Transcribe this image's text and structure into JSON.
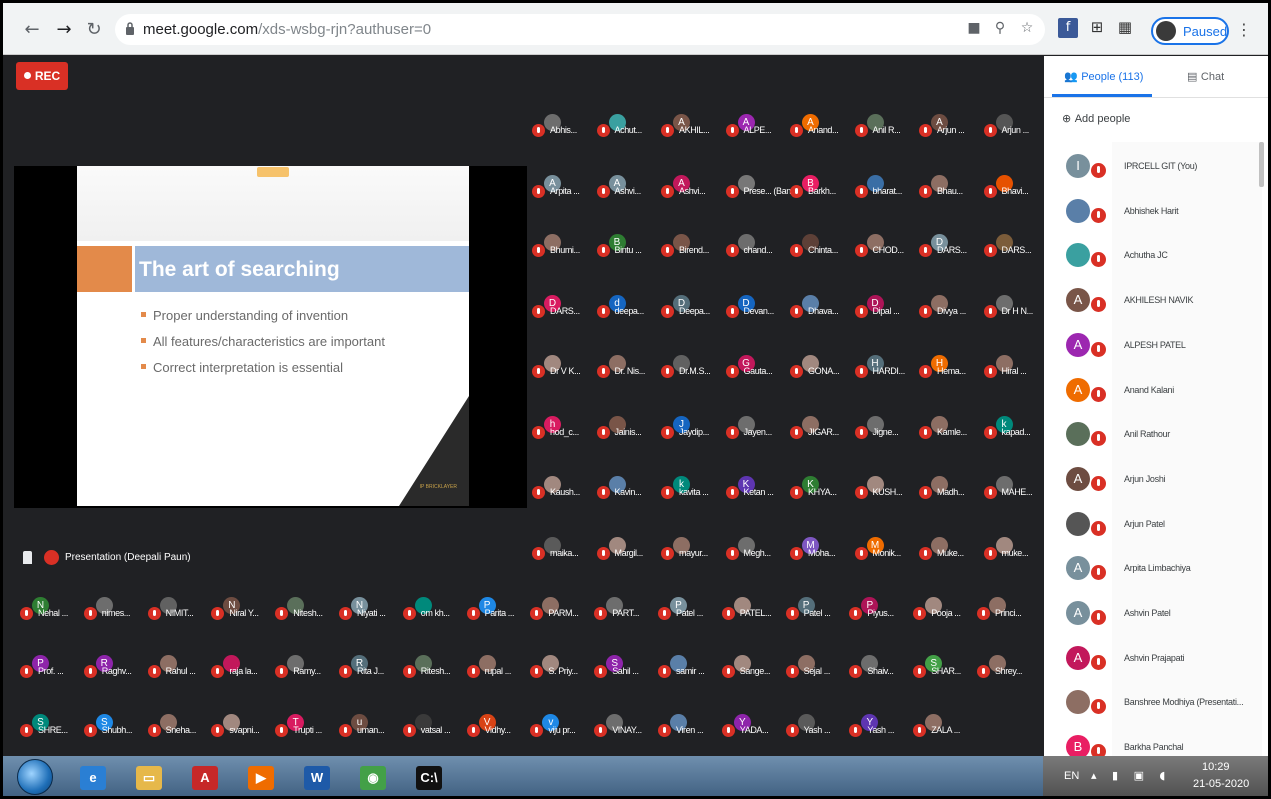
{
  "browser": {
    "url_host": "meet.google.com",
    "url_path": "/xds-wsbg-rjn?authuser=0",
    "profile_label": "Paused",
    "icons": [
      "back-icon",
      "forward-icon",
      "reload-icon",
      "lock-icon",
      "camera-icon",
      "zoom-icon",
      "star-icon",
      "facebook-icon",
      "extension-grid-icon",
      "grid-icon",
      "kebab-icon"
    ]
  },
  "meet": {
    "rec_label": "REC",
    "presentation_label": "Presentation (Deepali Paun)",
    "accent_color": "#d93025",
    "slide": {
      "title": "The art of searching",
      "bullets": [
        "Proper understanding of invention",
        "All features/characteristics are important",
        "Correct interpretation is essential"
      ],
      "logo_text": "IP BRICKLAYER"
    },
    "grid_rows": [
      [
        {
          "n": "Abhis...",
          "l": "",
          "c": "#6d6d6d"
        },
        {
          "n": "Achut...",
          "l": "",
          "c": "#3aa0a0"
        },
        {
          "n": "AKHIL...",
          "l": "A",
          "c": "#795548"
        },
        {
          "n": "ALPE...",
          "l": "A",
          "c": "#9c27b0"
        },
        {
          "n": "Anand...",
          "l": "A",
          "c": "#ef6c00"
        },
        {
          "n": "Anil R...",
          "l": "",
          "c": "#5a6f5a"
        },
        {
          "n": "Arjun ...",
          "l": "A",
          "c": "#6d4c41"
        },
        {
          "n": "Arjun ...",
          "l": "",
          "c": "#555"
        }
      ],
      [
        {
          "n": "Arpita ...",
          "l": "A",
          "c": "#78909c"
        },
        {
          "n": "Ashvi...",
          "l": "A",
          "c": "#78909c"
        },
        {
          "n": "Ashvi...",
          "l": "A",
          "c": "#c2185b"
        },
        {
          "n": "Prese... (Bans...",
          "l": "",
          "c": "#777"
        },
        {
          "n": "Barkh...",
          "l": "B",
          "c": "#e91e63"
        },
        {
          "n": "bharat...",
          "l": "",
          "c": "#3a6ea5"
        },
        {
          "n": "Bhau...",
          "l": "",
          "c": "#8d6e63"
        },
        {
          "n": "Bhavi...",
          "l": "",
          "c": "#e65100"
        }
      ],
      [
        {
          "n": "Bhumi...",
          "l": "",
          "c": "#8d6e63"
        },
        {
          "n": "Bintu ...",
          "l": "B",
          "c": "#2e7d32"
        },
        {
          "n": "Birend...",
          "l": "",
          "c": "#795548"
        },
        {
          "n": "chand...",
          "l": "",
          "c": "#6d6d6d"
        },
        {
          "n": "Chinta...",
          "l": "",
          "c": "#5d4037"
        },
        {
          "n": "CHOD...",
          "l": "",
          "c": "#8d6e63"
        },
        {
          "n": "DARS...",
          "l": "D",
          "c": "#78909c"
        },
        {
          "n": "DARS...",
          "l": "",
          "c": "#7b5c3a"
        }
      ],
      [
        {
          "n": "DARS...",
          "l": "D",
          "c": "#d81b60"
        },
        {
          "n": "deepa...",
          "l": "d",
          "c": "#1565c0"
        },
        {
          "n": "Deepa...",
          "l": "D",
          "c": "#546e7a"
        },
        {
          "n": "Devan...",
          "l": "D",
          "c": "#1565c0"
        },
        {
          "n": "Dhava...",
          "l": "",
          "c": "#5a7fa8"
        },
        {
          "n": "Dipal ...",
          "l": "D",
          "c": "#ad1457"
        },
        {
          "n": "Divya ...",
          "l": "",
          "c": "#8d6e63"
        },
        {
          "n": "Dr H N...",
          "l": "",
          "c": "#6d6d6d"
        }
      ],
      [
        {
          "n": "Dr V K...",
          "l": "",
          "c": "#a1887f"
        },
        {
          "n": "Dr. Nis...",
          "l": "",
          "c": "#8d6e63"
        },
        {
          "n": "Dr.M.S...",
          "l": "",
          "c": "#616161"
        },
        {
          "n": "Gauta...",
          "l": "G",
          "c": "#c2185b"
        },
        {
          "n": "GONA...",
          "l": "",
          "c": "#a1887f"
        },
        {
          "n": "HARDI...",
          "l": "H",
          "c": "#546e7a"
        },
        {
          "n": "Hema...",
          "l": "H",
          "c": "#ef6c00"
        },
        {
          "n": "Hiral ...",
          "l": "",
          "c": "#8d6e63"
        }
      ],
      [
        {
          "n": "hod_c...",
          "l": "h",
          "c": "#d81b60"
        },
        {
          "n": "Jainis...",
          "l": "",
          "c": "#795548"
        },
        {
          "n": "Jaydip...",
          "l": "J",
          "c": "#1565c0"
        },
        {
          "n": "Jayen...",
          "l": "",
          "c": "#6d6d6d"
        },
        {
          "n": "JIGAR...",
          "l": "",
          "c": "#8d6e63"
        },
        {
          "n": "Jigne...",
          "l": "",
          "c": "#6d6d6d"
        },
        {
          "n": "Kamle...",
          "l": "",
          "c": "#8d6e63"
        },
        {
          "n": "kapad...",
          "l": "k",
          "c": "#00897b"
        }
      ],
      [
        {
          "n": "Kaush...",
          "l": "",
          "c": "#a1887f"
        },
        {
          "n": "Kavin...",
          "l": "",
          "c": "#5a7fa8"
        },
        {
          "n": "kavita ...",
          "l": "k",
          "c": "#00897b"
        },
        {
          "n": "Ketan ...",
          "l": "K",
          "c": "#5e35b1"
        },
        {
          "n": "KHYA...",
          "l": "K",
          "c": "#2e7d32"
        },
        {
          "n": "KUSH...",
          "l": "",
          "c": "#a1887f"
        },
        {
          "n": "Madh...",
          "l": "",
          "c": "#8d6e63"
        },
        {
          "n": "MAHE...",
          "l": "",
          "c": "#6d6d6d"
        }
      ],
      [
        {
          "n": "maika...",
          "l": "",
          "c": "#5a5a5a"
        },
        {
          "n": "Margil...",
          "l": "",
          "c": "#a1887f"
        },
        {
          "n": "mayur...",
          "l": "",
          "c": "#8d6e63"
        },
        {
          "n": "Megh...",
          "l": "",
          "c": "#6d6d6d"
        },
        {
          "n": "Moha...",
          "l": "M",
          "c": "#7e57c2"
        },
        {
          "n": "Monik...",
          "l": "M",
          "c": "#ef6c00"
        },
        {
          "n": "Muke...",
          "l": "",
          "c": "#8d6e63"
        },
        {
          "n": "muke...",
          "l": "",
          "c": "#a1887f"
        }
      ],
      [
        {
          "n": "Nehal ...",
          "l": "N",
          "c": "#2e7d32"
        },
        {
          "n": "nimes...",
          "l": "",
          "c": "#6d6d6d"
        },
        {
          "n": "NIMIT...",
          "l": "",
          "c": "#616161"
        },
        {
          "n": "Niral Y...",
          "l": "N",
          "c": "#6d4c41"
        },
        {
          "n": "Nitesh...",
          "l": "",
          "c": "#5a6f5a"
        },
        {
          "n": "Niyati ...",
          "l": "N",
          "c": "#78909c"
        },
        {
          "n": "om kh...",
          "l": "",
          "c": "#00897b"
        },
        {
          "n": "Parita ...",
          "l": "P",
          "c": "#1e88e5"
        },
        {
          "n": "PARM...",
          "l": "",
          "c": "#8d6e63"
        },
        {
          "n": "PART...",
          "l": "",
          "c": "#6d6d6d"
        },
        {
          "n": "Patel ...",
          "l": "P",
          "c": "#78909c"
        },
        {
          "n": "PATEL...",
          "l": "",
          "c": "#a1887f"
        },
        {
          "n": "Patel ...",
          "l": "P",
          "c": "#546e7a"
        },
        {
          "n": "Piyus...",
          "l": "P",
          "c": "#ad1457"
        },
        {
          "n": "Pooja ...",
          "l": "",
          "c": "#a1887f"
        },
        {
          "n": "Princi...",
          "l": "",
          "c": "#8d6e63"
        }
      ],
      [
        {
          "n": "Prof. ...",
          "l": "P",
          "c": "#8e24aa"
        },
        {
          "n": "Raghv...",
          "l": "R",
          "c": "#8e24aa"
        },
        {
          "n": "Rahul ...",
          "l": "",
          "c": "#8d6e63"
        },
        {
          "n": "raja la...",
          "l": "",
          "c": "#c2185b"
        },
        {
          "n": "Ramy...",
          "l": "",
          "c": "#6d6d6d"
        },
        {
          "n": "Rita J...",
          "l": "R",
          "c": "#546e7a"
        },
        {
          "n": "Ritesh...",
          "l": "",
          "c": "#5a6f5a"
        },
        {
          "n": "rupal ...",
          "l": "",
          "c": "#8d6e63"
        },
        {
          "n": "S. Priy...",
          "l": "",
          "c": "#a1887f"
        },
        {
          "n": "Sahil ...",
          "l": "S",
          "c": "#8e24aa"
        },
        {
          "n": "samir ...",
          "l": "",
          "c": "#5a7fa8"
        },
        {
          "n": "Sange...",
          "l": "",
          "c": "#a1887f"
        },
        {
          "n": "Sejal ...",
          "l": "",
          "c": "#8d6e63"
        },
        {
          "n": "Shaiv...",
          "l": "",
          "c": "#6d6d6d"
        },
        {
          "n": "SHAR...",
          "l": "S",
          "c": "#43a047"
        },
        {
          "n": "Shrey...",
          "l": "",
          "c": "#8d6e63"
        }
      ],
      [
        {
          "n": "SHRE...",
          "l": "S",
          "c": "#00897b"
        },
        {
          "n": "Shubh...",
          "l": "S",
          "c": "#1e88e5"
        },
        {
          "n": "Sneha...",
          "l": "",
          "c": "#8d6e63"
        },
        {
          "n": "svapni...",
          "l": "",
          "c": "#a1887f"
        },
        {
          "n": "Trupti ...",
          "l": "T",
          "c": "#d81b60"
        },
        {
          "n": "uman...",
          "l": "u",
          "c": "#6d4c41"
        },
        {
          "n": "vatsal ...",
          "l": "",
          "c": "#3a3a3a"
        },
        {
          "n": "Vidhy...",
          "l": "V",
          "c": "#d84315"
        },
        {
          "n": "viju pr...",
          "l": "v",
          "c": "#1e88e5"
        },
        {
          "n": "VINAY...",
          "l": "",
          "c": "#6d6d6d"
        },
        {
          "n": "Viren ...",
          "l": "",
          "c": "#5a7fa8"
        },
        {
          "n": "YADA...",
          "l": "Y",
          "c": "#8e24aa"
        },
        {
          "n": "Yash ...",
          "l": "",
          "c": "#5a5a5a"
        },
        {
          "n": "Yash ...",
          "l": "Y",
          "c": "#5e35b1"
        },
        {
          "n": "ZALA ...",
          "l": "",
          "c": "#8d6e63"
        }
      ]
    ]
  },
  "panel": {
    "tab_people": "People (113)",
    "tab_chat": "Chat",
    "add_people": "Add people",
    "participants": [
      {
        "n": "IPRCELL GIT (You)",
        "l": "I",
        "c": "#78909c"
      },
      {
        "n": "Abhishek Harit",
        "l": "",
        "c": "#5a7fa8"
      },
      {
        "n": "Achutha JC",
        "l": "",
        "c": "#3aa0a0"
      },
      {
        "n": "AKHILESH NAVIK",
        "l": "A",
        "c": "#795548"
      },
      {
        "n": "ALPESH PATEL",
        "l": "A",
        "c": "#9c27b0"
      },
      {
        "n": "Anand Kalani",
        "l": "A",
        "c": "#ef6c00"
      },
      {
        "n": "Anil Rathour",
        "l": "",
        "c": "#5a6f5a"
      },
      {
        "n": "Arjun Joshi",
        "l": "A",
        "c": "#6d4c41"
      },
      {
        "n": "Arjun Patel",
        "l": "",
        "c": "#555555"
      },
      {
        "n": "Arpita Limbachiya",
        "l": "A",
        "c": "#78909c"
      },
      {
        "n": "Ashvin Patel",
        "l": "A",
        "c": "#78909c"
      },
      {
        "n": "Ashvin Prajapati",
        "l": "A",
        "c": "#c2185b"
      },
      {
        "n": "Banshree Modhiya (Presentati...",
        "l": "",
        "c": "#8d6e63"
      },
      {
        "n": "Barkha Panchal",
        "l": "B",
        "c": "#e91e63"
      }
    ]
  },
  "taskbar": {
    "apps": [
      {
        "name": "ie",
        "glyph": "e",
        "color": "#2a7fd4"
      },
      {
        "name": "explorer",
        "glyph": "▭",
        "color": "#e6b84a"
      },
      {
        "name": "acrobat",
        "glyph": "A",
        "color": "#c62828"
      },
      {
        "name": "media",
        "glyph": "▶",
        "color": "#ef6c00"
      },
      {
        "name": "word",
        "glyph": "W",
        "color": "#1e5aa8"
      },
      {
        "name": "chrome",
        "glyph": "◉",
        "color": "#43a047"
      },
      {
        "name": "cmd",
        "glyph": "C:\\",
        "color": "#111111"
      }
    ],
    "lang": "EN",
    "time": "10:29",
    "date": "21-05-2020"
  }
}
